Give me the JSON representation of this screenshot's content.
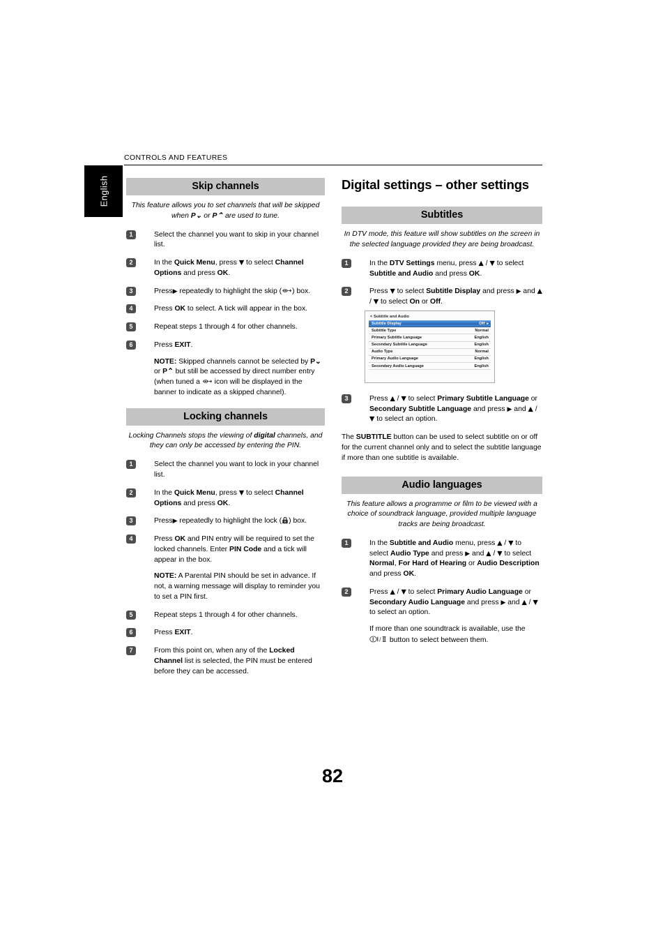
{
  "running_head": "CONTROLS AND FEATURES",
  "language_tab": "English",
  "page_number": "82",
  "left_column": {
    "section_1": {
      "heading": "Skip channels",
      "intro_1": "This feature allows you to set channels that will be skipped",
      "intro_2_a": "when ",
      "intro_2_pdown": "P⌄",
      "intro_2_b": " or ",
      "intro_2_pup": "P⌃",
      "intro_2_c": " are used to tune.",
      "steps": [
        {
          "num": "1",
          "text": "Select the channel you want to skip in your channel list."
        },
        {
          "num": "2",
          "pre": "In the ",
          "b1": "Quick Menu",
          "mid1": ", press ",
          "arrow": "down",
          "mid2": " to select ",
          "b2": "Channel Options",
          "mid3": " and press ",
          "b3": "OK",
          "post": "."
        },
        {
          "num": "3",
          "pre": "Press",
          "arrow": "right",
          "mid": " repeatedly to highlight the skip (",
          "icon": "skip-icon",
          "post": ") box."
        },
        {
          "num": "4",
          "pre": "Press ",
          "b1": "OK",
          "post": " to select. A tick will appear in the box."
        },
        {
          "num": "5",
          "text": "Repeat steps 1 through 4 for other channels."
        },
        {
          "num": "6",
          "pre": "Press ",
          "b1": "EXIT",
          "post": "."
        }
      ],
      "note_label": "NOTE:",
      "note_a": " Skipped channels cannot be selected by ",
      "note_pdown": "P⌄",
      "note_b": " or ",
      "note_pup": "P⌃",
      "note_c": " but still be accessed by direct number entry (when tuned a ",
      "note_icon": "skip-icon",
      "note_d": " icon will be displayed in the banner to indicate as a skipped channel)."
    },
    "section_2": {
      "heading": "Locking channels",
      "intro_a": "Locking Channels stops the viewing of ",
      "intro_b": "digital",
      "intro_c": " channels, and they can only be accessed by entering the PIN.",
      "steps": [
        {
          "num": "1",
          "text": "Select the channel you want to lock in your channel list."
        },
        {
          "num": "2",
          "pre": "In the ",
          "b1": "Quick Menu",
          "mid1": ", press ",
          "arrow": "down",
          "mid2": " to select ",
          "b2": "Channel Options",
          "mid3": " and press ",
          "b3": "OK",
          "post": "."
        },
        {
          "num": "3",
          "pre": "Press",
          "arrow": "right",
          "mid": " repeatedly to highlight the lock (",
          "icon": "lock-icon",
          "post": ") box."
        },
        {
          "num": "4",
          "pre": "Press ",
          "b1": "OK",
          "mid1": " and PIN entry will be required to set the locked channels. Enter ",
          "b2": "PIN Code",
          "post": " and a tick will appear in the box.",
          "note_label": "NOTE:",
          "note_text": " A Parental PIN should be set in advance. If not, a warning message will display to reminder you to set a PIN first."
        },
        {
          "num": "5",
          "text": "Repeat steps 1 through 4 for other channels."
        },
        {
          "num": "6",
          "pre": "Press ",
          "b1": "EXIT",
          "post": "."
        },
        {
          "num": "7",
          "pre": "From this point on, when any of the ",
          "b1": "Locked Channel",
          "post": " list is selected, the PIN must be entered before they can be accessed."
        }
      ]
    }
  },
  "right_column": {
    "chapter_title": "Digital settings – other settings",
    "section_1": {
      "heading": "Subtitles",
      "intro": "In DTV mode, this feature will show subtitles on the screen in the selected language provided they are being broadcast.",
      "steps": [
        {
          "num": "1",
          "pre": "In the ",
          "b1": "DTV Settings",
          "mid1": " menu, press ",
          "arrows": "up-down",
          "mid2": " to select ",
          "b2": "Subtitle and Audio",
          "mid3": " and press ",
          "b3": "OK",
          "post": "."
        },
        {
          "num": "2",
          "pre": "Press ",
          "arrow": "down",
          "mid1": " to select ",
          "b1": "Subtitle Display",
          "mid2": " and press ",
          "arrow2": "right",
          "mid3": " and ",
          "arrows2": "up-down",
          "mid4": " to select ",
          "b2": "On",
          "mid5": " or ",
          "b3": "Off",
          "post": "."
        },
        {
          "num": "3",
          "pre": "Press ",
          "arrows": "up-down",
          "mid1": " to select ",
          "b1": "Primary Subtitle Language",
          "mid2": " or ",
          "b2": "Secondary Subtitle Language",
          "mid3": " and press ",
          "arrow2": "right",
          "mid4": " and ",
          "arrows2": "up-down",
          "post": " to select an option."
        }
      ],
      "closing_a": "The ",
      "closing_b": "SUBTITLE",
      "closing_c": " button can be used to select subtitle on or off for the current channel only and to select the subtitle language if more than one subtitle is available."
    },
    "osd_menu": {
      "title": "< Subtitle and Audio",
      "back_icon": "back-chevron-icon",
      "rows": [
        {
          "label": "Subtitle Display",
          "value": "Off",
          "selected": true,
          "arrow": "▸"
        },
        {
          "label": "Subtitle Type",
          "value": "Normal",
          "selected": false
        },
        {
          "label": "Primary Subtitle Language",
          "value": "English",
          "selected": false
        },
        {
          "label": "Secondary Subtitle Language",
          "value": "English",
          "selected": false
        },
        {
          "label": "Audio Type",
          "value": "Normal",
          "selected": false
        },
        {
          "label": "Primary Audio Language",
          "value": "English",
          "selected": false
        },
        {
          "label": "Secondary Audio Language",
          "value": "English",
          "selected": false
        }
      ],
      "selected_row_color": "#2f6fbe"
    },
    "section_2": {
      "heading": "Audio languages",
      "intro": "This feature allows a programme or film to be viewed with a choice of soundtrack language, provided multiple language tracks are being broadcast.",
      "steps": [
        {
          "num": "1",
          "pre": "In the ",
          "b1": "Subtitle and Audio",
          "mid1": " menu, press ",
          "arrows": "up-down",
          "mid2": " to select ",
          "b2": "Audio Type",
          "mid3": " and press ",
          "arrow2": "right",
          "mid4": " and ",
          "arrows2": "up-down",
          "mid5": " to select ",
          "b3": "Normal",
          "mid6": ", ",
          "b4": "For Hard of Hearing",
          "mid7": " or ",
          "b5": "Audio Description",
          "mid8": " and press ",
          "b6": "OK",
          "post": "."
        },
        {
          "num": "2",
          "pre": "Press ",
          "arrows": "up-down",
          "mid1": " to select ",
          "b1": "Primary Audio Language",
          "mid2": " or ",
          "b2": "Secondary Audio Language",
          "mid3": " and press ",
          "arrow2": "right",
          "mid4": " and ",
          "arrows2": "up-down",
          "post": " to select an option.",
          "closing_a": "If more than one soundtrack is available, use the ",
          "closing_icon": "mono-stereo-button-icon",
          "closing_b": " button to select between them."
        }
      ]
    }
  },
  "colors": {
    "section_bar": "#c3c3c3",
    "badge": "#4d4d4d",
    "tab": "#000000",
    "osd_highlight": "#2f6fbe"
  }
}
